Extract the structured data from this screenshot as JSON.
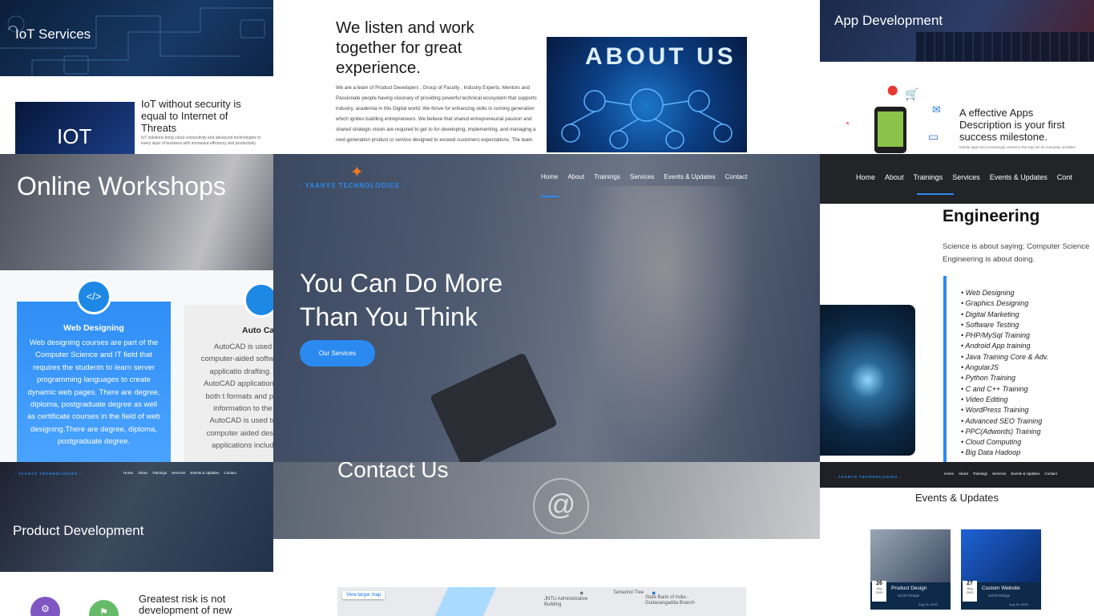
{
  "iot_services": {
    "title": "IoT Services"
  },
  "iot_article": {
    "thumb_label": "IOT",
    "title": "IoT without security is equal to Internet of Threats",
    "excerpt": "IoT solutions bring cloud connectivity and advanced technologies to every layer of business with increased efficiency and productivity"
  },
  "about": {
    "heading": "We listen and work together for great experience.",
    "body": "We are a team of Product Developers , Group of Faculty , Industry Experts, Mentors and Passionate people having visionary of providing powerful technical ecosystem that supports industry, academia in this Digital world. We thrive for enhancing skills in coming generation which ignites budding entrepreneurs. We believe that shared entrepreneurial passion and shared strategic vision are required to get to for developing, implementing, and managing a next-generation product or service designed to exceed customers expectations. The team",
    "image_label": "ABOUT US"
  },
  "app_dev": {
    "title": "App Development"
  },
  "apps_promo": {
    "text": "A effective Apps Description is your first success milestone.",
    "sub": "Mobile apps are increasingly central to the way we do everyday activities"
  },
  "workshops": {
    "title": "Online Workshops"
  },
  "web_card": {
    "title": "Web Designing",
    "body": "Web designing courses are part of the Computer Science and IT field that requires the students to learn server programming languages to create dynamic web pages. There are degree, diploma, postgraduate degree as well as certificate courses in the field of web designing.There are degree, diploma, postgraduate degree."
  },
  "autocad_card": {
    "title": "Auto Ca",
    "body": "AutoCAD is used computer-aided software applicatio drafting. - AutoCAD application in both t formats and pro information to the AutoCAD is used to computer aided desig applications includ"
  },
  "hero": {
    "brand": "- YAANYS TECHNOLOGIES -",
    "nav": [
      "Home",
      "About",
      "Trainings",
      "Services",
      "Events & Updates",
      "Contact"
    ],
    "headline_1": "You Can Do More",
    "headline_2": "Than You Think",
    "cta": "Our Services"
  },
  "dark_nav": {
    "items": [
      "Home",
      "About",
      "Trainings",
      "Services",
      "Events & Updates",
      "Cont"
    ]
  },
  "engineering": {
    "heading": "Engineering",
    "quote": "Science is about saying; Computer Science Engineering is about doing.",
    "trainings": [
      "Web Designing",
      "Graphics Designing",
      "Digital Marketing",
      "Software Testing",
      "PHP/MySql Training",
      "Android App training",
      "Java Training Core & Adv.",
      "AngularJS",
      "Python Training",
      "C and C++ Training",
      "Video Editing",
      "WordPress Training",
      "Advanced SEO Training",
      "PPC(Adwords) Training",
      "Cloud Computing",
      "Big Data Hadoop"
    ]
  },
  "product_dev": {
    "brand": "- YAANYS TECHNOLOGIES -",
    "nav": [
      "Home",
      "About",
      "Trainings",
      "Services",
      "Events & Updates",
      "Contact"
    ],
    "title": "Product Development"
  },
  "contact": {
    "title": "Contact Us",
    "at": "@"
  },
  "risk": {
    "text": "Greatest risk is not development of new"
  },
  "map": {
    "link": "View larger map",
    "labels": [
      "JNTU Administrative Building",
      "State Bank of India - Godavarigadda Branch",
      "Tamarind Tree"
    ]
  },
  "events": {
    "brand": "- YAANYS TECHNOLOGIES -",
    "nav": [
      "Home",
      "About",
      "Trainings",
      "Services",
      "Events & Updates",
      "Contact"
    ],
    "title": "Events & Updates",
    "cards": [
      {
        "day": "26",
        "month": "Aug",
        "year": "2020",
        "title": "Product Design",
        "sub": "UI/UX Design",
        "date": "Aug 26, 2020"
      },
      {
        "day": "27",
        "month": "Aug",
        "year": "2020",
        "title": "Custom Website",
        "sub": "UI/UX Design",
        "date": "Aug 26, 2020"
      }
    ]
  },
  "colors": {
    "accent": "#2b8af0",
    "dark_nav": "#222428",
    "blue_card": "#2f8ef5"
  }
}
